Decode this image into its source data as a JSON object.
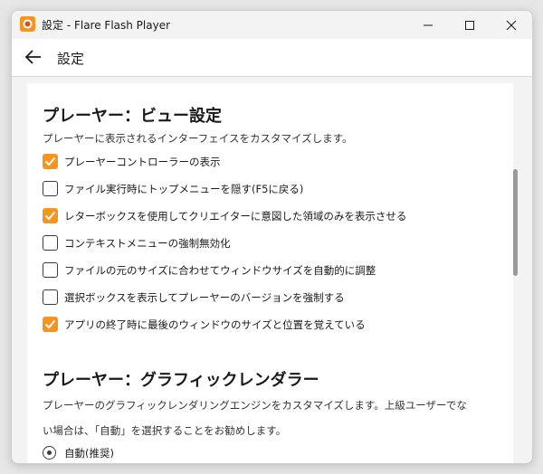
{
  "window": {
    "title": "設定 - Flare Flash Player"
  },
  "navbar": {
    "title": "設定"
  },
  "colors": {
    "accent": "#f7941d",
    "window_bg": "#f3f3f3",
    "content_bg": "#ffffff"
  },
  "view_section": {
    "title": "プレーヤー：ビュー設定",
    "description": "プレーヤーに表示されるインターフェイスをカスタマイズします。",
    "options": [
      {
        "label": "プレーヤーコントローラーの表示",
        "checked": true
      },
      {
        "label": "ファイル実行時にトップメニューを隠す(F5に戻る)",
        "checked": false
      },
      {
        "label": "レターボックスを使用してクリエイターに意図した領域のみを表示させる",
        "checked": true
      },
      {
        "label": "コンテキストメニューの強制無効化",
        "checked": false
      },
      {
        "label": "ファイルの元のサイズに合わせてウィンドウサイズを自動的に調整",
        "checked": false
      },
      {
        "label": "選択ボックスを表示してプレーヤーのバージョンを強制する",
        "checked": false
      },
      {
        "label": "アプリの終了時に最後のウィンドウのサイズと位置を覚えている",
        "checked": true
      }
    ]
  },
  "graphics_section": {
    "title": "プレーヤー：グラフィックレンダラー",
    "description_line1": "プレーヤーのグラフィックレンダリングエンジンをカスタマイズします。上級ユーザーでな",
    "description_line2": "い場合は、「自動」を選択することをお勧めします。",
    "radio_label": "自動(推奨)"
  }
}
